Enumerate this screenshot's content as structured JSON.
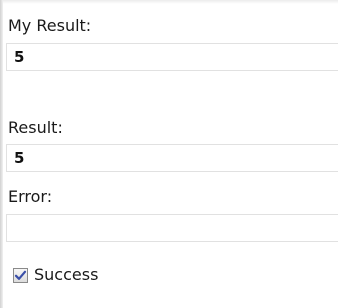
{
  "form": {
    "my_result": {
      "label": "My Result:",
      "value": "5"
    },
    "result": {
      "label": "Result:",
      "value": "5"
    },
    "error": {
      "label": "Error:",
      "value": ""
    },
    "success": {
      "label": "Success",
      "checked": true
    }
  },
  "colors": {
    "field_border": "#e1e1e1",
    "checkmark": "#3a4fa8",
    "text": "#1a1a1a"
  },
  "icons": {
    "checkbox": "checkmark-icon"
  }
}
